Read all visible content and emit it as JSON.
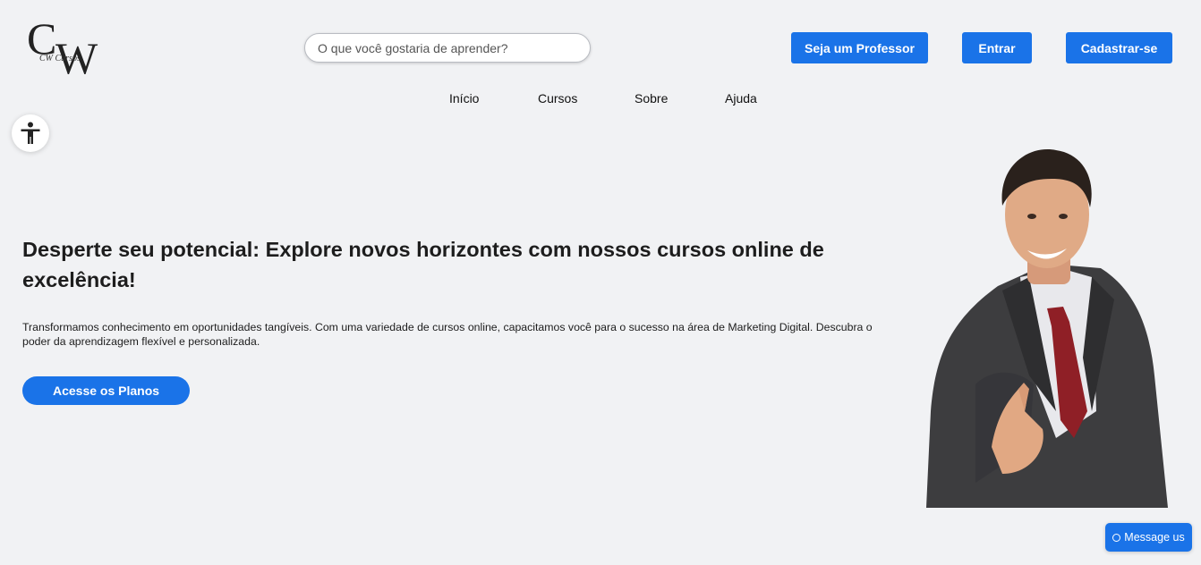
{
  "header": {
    "logo_text": "CW Cursos",
    "search": {
      "placeholder": "O que você gostaria de aprender?",
      "value": ""
    },
    "buttons": {
      "professor": "Seja um Professor",
      "entrar": "Entrar",
      "cadastrar": "Cadastrar-se"
    }
  },
  "nav": {
    "items": [
      {
        "label": "Início"
      },
      {
        "label": "Cursos"
      },
      {
        "label": "Sobre"
      },
      {
        "label": "Ajuda"
      }
    ]
  },
  "accessibility": {
    "icon": "accessibility-icon"
  },
  "hero": {
    "headline": "Desperte seu potencial: Explore novos horizontes com nossos cursos online de excelência!",
    "description": "Transformamos conhecimento em oportunidades tangíveis. Com uma variedade de cursos online, capacitamos você para o sucesso na área de Marketing Digital. Descubra o poder da aprendizagem flexível e personalizada.",
    "cta": "Acesse os Planos"
  },
  "chat": {
    "label": "Message us"
  },
  "colors": {
    "accent": "#1a73e8",
    "background": "#f1f2f4"
  }
}
